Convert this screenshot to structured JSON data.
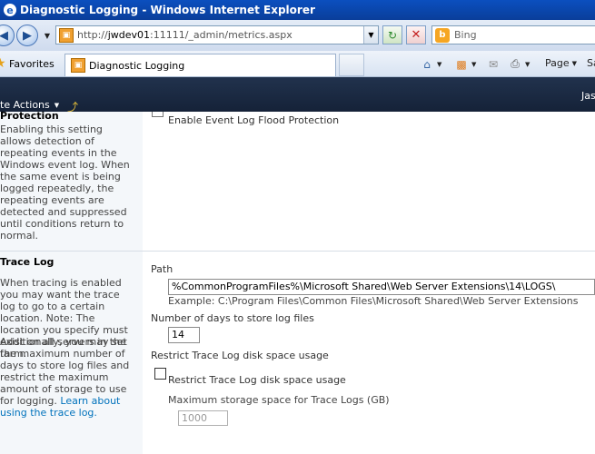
{
  "window": {
    "title": "Diagnostic Logging - Windows Internet Explorer",
    "logo": "e"
  },
  "addressbar": {
    "url_prefix": "http://",
    "url_host": "jwdev01",
    "url_rest": ":11111/_admin/metrics.aspx",
    "search_placeholder": "Bing"
  },
  "favorites": {
    "label": "Favorites",
    "tab_label": "Diagnostic Logging",
    "page_menu": "Page",
    "safety_menu": "Sa"
  },
  "spbar": {
    "site_actions": "te Actions",
    "user": "Jas"
  },
  "event_log": {
    "heading": "Protection",
    "description": "Enabling this setting allows detection of repeating events in the Windows event log. When the same event is being logged repeatedly, the repeating events are detected and suppressed until conditions return to normal.",
    "option_label": "Enable Event Log Flood Protection"
  },
  "trace_log": {
    "heading": "Trace Log",
    "description1": "When tracing is enabled you may want the trace log to go to a certain location. Note: The location you specify must exist on all servers in the farm.",
    "description2": "Additionally, you may set the maximum number of days to store log files and restrict the maximum amount of storage to use for logging.",
    "learn_more_link": "Learn about using the trace log.",
    "path_label": "Path",
    "path_value": "%CommonProgramFiles%\\Microsoft Shared\\Web Server Extensions\\14\\LOGS\\",
    "path_example": "Example: C:\\Program Files\\Common Files\\Microsoft Shared\\Web Server Extensions",
    "days_label": "Number of days to store log files",
    "days_value": "14",
    "restrict_heading": "Restrict Trace Log disk space usage",
    "restrict_checkbox_label": "Restrict Trace Log disk space usage",
    "restrict_checked": false,
    "max_storage_label": "Maximum storage space for Trace Logs (GB)",
    "max_storage_value": "1000"
  },
  "icons": {
    "back": "back-arrow-icon",
    "forward": "forward-arrow-icon",
    "refresh": "refresh-icon",
    "stop": "stop-icon",
    "home": "home-icon",
    "feeds": "feeds-icon",
    "mail": "mail-icon",
    "print": "print-icon"
  },
  "colors": {
    "titlebar": "#0b4fbf",
    "sharepoint_bar": "#1b2a42",
    "link": "#0072bc",
    "left_column": "#f4f7fa"
  }
}
